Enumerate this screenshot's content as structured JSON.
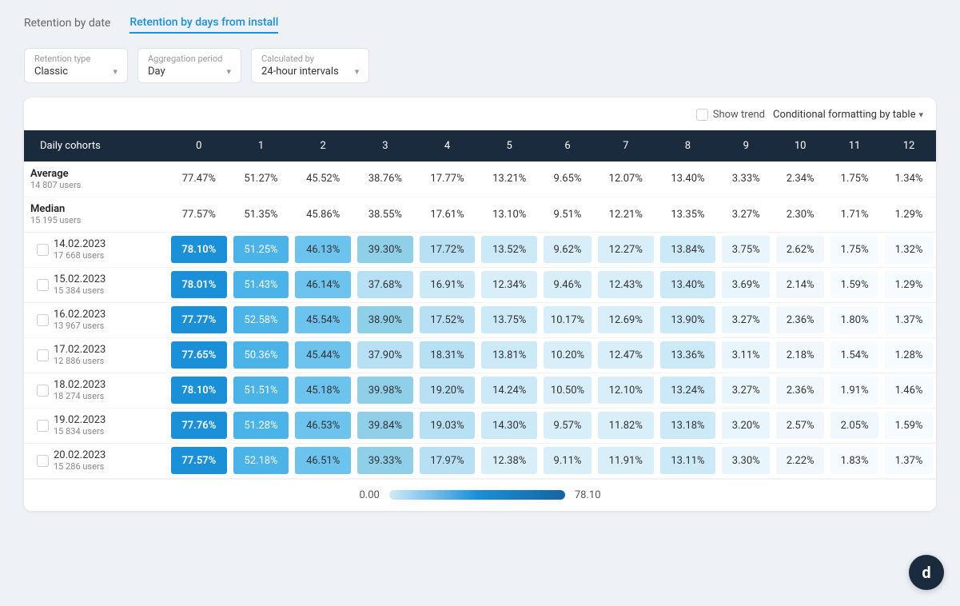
{
  "tabs": [
    {
      "id": "by-date",
      "label": "Retention by date",
      "active": false
    },
    {
      "id": "by-install",
      "label": "Retention by days from install",
      "active": true
    }
  ],
  "filters": [
    {
      "id": "retention-type",
      "label": "Retention type",
      "value": "Classic"
    },
    {
      "id": "aggregation-period",
      "label": "Aggregation period",
      "value": "Day"
    },
    {
      "id": "calculated-by",
      "label": "Calculated by",
      "value": "24-hour intervals"
    }
  ],
  "card": {
    "show_trend_label": "Show trend",
    "conditional_format_label": "Conditional formatting by table"
  },
  "table": {
    "header": {
      "cohort_label": "Daily cohorts",
      "columns": [
        "0",
        "1",
        "2",
        "3",
        "4",
        "5",
        "6",
        "7",
        "8",
        "9",
        "10",
        "11",
        "12"
      ]
    },
    "summary_rows": [
      {
        "label": "Average",
        "sublabel": "14 807 users",
        "values": [
          "77.47%",
          "51.27%",
          "45.52%",
          "38.76%",
          "17.77%",
          "13.21%",
          "9.65%",
          "12.07%",
          "13.40%",
          "3.33%",
          "2.34%",
          "1.75%",
          "1.34%"
        ]
      },
      {
        "label": "Median",
        "sublabel": "15 195 users",
        "values": [
          "77.57%",
          "51.35%",
          "45.86%",
          "38.55%",
          "17.61%",
          "13.10%",
          "9.51%",
          "12.21%",
          "13.35%",
          "3.27%",
          "2.30%",
          "1.71%",
          "1.29%"
        ]
      }
    ],
    "data_rows": [
      {
        "date": "14.02.2023",
        "users": "17 668 users",
        "values": [
          "78.10%",
          "51.25%",
          "46.13%",
          "39.30%",
          "17.72%",
          "13.52%",
          "9.62%",
          "12.27%",
          "13.84%",
          "3.75%",
          "2.62%",
          "1.75%",
          "1.32%"
        ]
      },
      {
        "date": "15.02.2023",
        "users": "15 384 users",
        "values": [
          "78.01%",
          "51.43%",
          "46.14%",
          "37.68%",
          "16.91%",
          "12.34%",
          "9.46%",
          "12.43%",
          "13.40%",
          "3.69%",
          "2.14%",
          "1.59%",
          "1.29%"
        ]
      },
      {
        "date": "16.02.2023",
        "users": "13 967 users",
        "values": [
          "77.77%",
          "52.58%",
          "45.54%",
          "38.90%",
          "17.52%",
          "13.75%",
          "10.17%",
          "12.69%",
          "13.90%",
          "3.27%",
          "2.36%",
          "1.80%",
          "1.37%"
        ]
      },
      {
        "date": "17.02.2023",
        "users": "12 886 users",
        "values": [
          "77.65%",
          "50.36%",
          "45.44%",
          "37.90%",
          "18.31%",
          "13.81%",
          "10.20%",
          "12.47%",
          "13.36%",
          "3.11%",
          "2.18%",
          "1.54%",
          "1.28%"
        ]
      },
      {
        "date": "18.02.2023",
        "users": "18 274 users",
        "values": [
          "78.10%",
          "51.51%",
          "45.18%",
          "39.98%",
          "19.20%",
          "14.24%",
          "10.50%",
          "12.10%",
          "13.24%",
          "3.27%",
          "2.36%",
          "1.91%",
          "1.46%"
        ]
      },
      {
        "date": "19.02.2023",
        "users": "15 834 users",
        "values": [
          "77.76%",
          "51.28%",
          "46.53%",
          "39.84%",
          "19.03%",
          "14.30%",
          "9.57%",
          "11.82%",
          "13.18%",
          "3.20%",
          "2.57%",
          "2.05%",
          "1.59%"
        ]
      },
      {
        "date": "20.02.2023",
        "users": "15 286 users",
        "values": [
          "77.57%",
          "52.18%",
          "46.51%",
          "39.33%",
          "17.97%",
          "12.38%",
          "9.11%",
          "11.91%",
          "13.11%",
          "3.30%",
          "2.22%",
          "1.83%",
          "1.37%"
        ]
      }
    ]
  },
  "legend": {
    "min_label": "0.00",
    "max_label": "78.10"
  },
  "logo": "d"
}
